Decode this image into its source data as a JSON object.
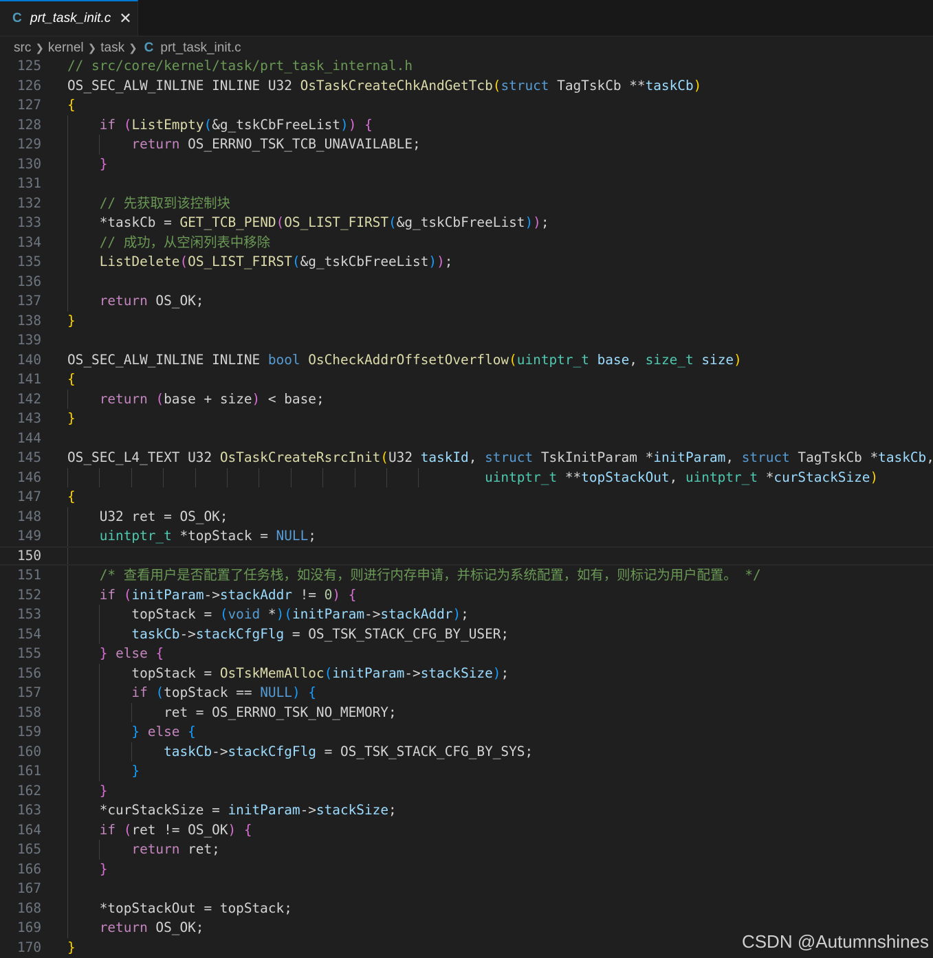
{
  "tab": {
    "icon": "C",
    "title": "prt_task_init.c",
    "close": "✕"
  },
  "breadcrumb": {
    "items": [
      "src",
      "kernel",
      "task"
    ],
    "file_icon": "C",
    "file": "prt_task_init.c"
  },
  "editor": {
    "current_line": 150,
    "lines": [
      {
        "n": "125",
        "g": [],
        "t": [
          [
            "m",
            "// src/core/kernel/task/prt_task_internal.h"
          ]
        ]
      },
      {
        "n": "126",
        "g": [],
        "t": [
          [
            "p",
            "OS_SEC_ALW_INLINE INLINE U32 "
          ],
          [
            "f",
            "OsTaskCreateChkAndGetTcb"
          ],
          [
            "b1",
            "("
          ],
          [
            "k",
            "struct"
          ],
          [
            "p",
            " TagTskCb **"
          ],
          [
            "v",
            "taskCb"
          ],
          [
            "b1",
            ")"
          ]
        ]
      },
      {
        "n": "127",
        "g": [],
        "t": [
          [
            "b1",
            "{"
          ]
        ]
      },
      {
        "n": "128",
        "g": [
          0
        ],
        "t": [
          [
            "p",
            "    "
          ],
          [
            "c",
            "if"
          ],
          [
            "p",
            " "
          ],
          [
            "b2",
            "("
          ],
          [
            "f",
            "ListEmpty"
          ],
          [
            "b3",
            "("
          ],
          [
            "p",
            "&g_tskCbFreeList"
          ],
          [
            "b3",
            ")"
          ],
          [
            "b2",
            ")"
          ],
          [
            "p",
            " "
          ],
          [
            "b2",
            "{"
          ]
        ]
      },
      {
        "n": "129",
        "g": [
          0,
          1
        ],
        "t": [
          [
            "p",
            "        "
          ],
          [
            "c",
            "return"
          ],
          [
            "p",
            " OS_ERRNO_TSK_TCB_UNAVAILABLE;"
          ]
        ]
      },
      {
        "n": "130",
        "g": [
          0
        ],
        "t": [
          [
            "p",
            "    "
          ],
          [
            "b2",
            "}"
          ]
        ]
      },
      {
        "n": "131",
        "g": [
          0
        ],
        "t": []
      },
      {
        "n": "132",
        "g": [
          0
        ],
        "t": [
          [
            "p",
            "    "
          ],
          [
            "m",
            "// 先获取到该控制块"
          ]
        ]
      },
      {
        "n": "133",
        "g": [
          0
        ],
        "t": [
          [
            "p",
            "    *taskCb = "
          ],
          [
            "f",
            "GET_TCB_PEND"
          ],
          [
            "b2",
            "("
          ],
          [
            "f",
            "OS_LIST_FIRST"
          ],
          [
            "b3",
            "("
          ],
          [
            "p",
            "&g_tskCbFreeList"
          ],
          [
            "b3",
            ")"
          ],
          [
            "b2",
            ")"
          ],
          [
            "p",
            ";"
          ]
        ]
      },
      {
        "n": "134",
        "g": [
          0
        ],
        "t": [
          [
            "p",
            "    "
          ],
          [
            "m",
            "// 成功，从空闲列表中移除"
          ]
        ]
      },
      {
        "n": "135",
        "g": [
          0
        ],
        "t": [
          [
            "p",
            "    "
          ],
          [
            "f",
            "ListDelete"
          ],
          [
            "b2",
            "("
          ],
          [
            "f",
            "OS_LIST_FIRST"
          ],
          [
            "b3",
            "("
          ],
          [
            "p",
            "&g_tskCbFreeList"
          ],
          [
            "b3",
            ")"
          ],
          [
            "b2",
            ")"
          ],
          [
            "p",
            ";"
          ]
        ]
      },
      {
        "n": "136",
        "g": [
          0
        ],
        "t": []
      },
      {
        "n": "137",
        "g": [
          0
        ],
        "t": [
          [
            "p",
            "    "
          ],
          [
            "c",
            "return"
          ],
          [
            "p",
            " OS_OK;"
          ]
        ]
      },
      {
        "n": "138",
        "g": [],
        "t": [
          [
            "b1",
            "}"
          ]
        ]
      },
      {
        "n": "139",
        "g": [],
        "t": []
      },
      {
        "n": "140",
        "g": [],
        "t": [
          [
            "p",
            "OS_SEC_ALW_INLINE INLINE "
          ],
          [
            "k",
            "bool"
          ],
          [
            "p",
            " "
          ],
          [
            "f",
            "OsCheckAddrOffsetOverflow"
          ],
          [
            "b1",
            "("
          ],
          [
            "t",
            "uintptr_t"
          ],
          [
            "p",
            " "
          ],
          [
            "v",
            "base"
          ],
          [
            "p",
            ", "
          ],
          [
            "t",
            "size_t"
          ],
          [
            "p",
            " "
          ],
          [
            "v",
            "size"
          ],
          [
            "b1",
            ")"
          ]
        ]
      },
      {
        "n": "141",
        "g": [],
        "t": [
          [
            "b1",
            "{"
          ]
        ]
      },
      {
        "n": "142",
        "g": [
          0
        ],
        "t": [
          [
            "p",
            "    "
          ],
          [
            "c",
            "return"
          ],
          [
            "p",
            " "
          ],
          [
            "b2",
            "("
          ],
          [
            "p",
            "base + size"
          ],
          [
            "b2",
            ")"
          ],
          [
            "p",
            " < base;"
          ]
        ]
      },
      {
        "n": "143",
        "g": [],
        "t": [
          [
            "b1",
            "}"
          ]
        ]
      },
      {
        "n": "144",
        "g": [],
        "t": []
      },
      {
        "n": "145",
        "g": [],
        "t": [
          [
            "p",
            "OS_SEC_L4_TEXT U32 "
          ],
          [
            "f",
            "OsTaskCreateRsrcInit"
          ],
          [
            "b1",
            "("
          ],
          [
            "p",
            "U32 "
          ],
          [
            "v",
            "taskId"
          ],
          [
            "p",
            ", "
          ],
          [
            "k",
            "struct"
          ],
          [
            "p",
            " TskInitParam *"
          ],
          [
            "v",
            "initParam"
          ],
          [
            "p",
            ", "
          ],
          [
            "k",
            "struct"
          ],
          [
            "p",
            " TagTskCb *"
          ],
          [
            "v",
            "taskCb"
          ],
          [
            "p",
            ","
          ]
        ]
      },
      {
        "n": "146",
        "g": [
          0,
          1,
          2,
          3,
          4,
          5,
          6,
          7,
          8,
          9,
          10,
          11
        ],
        "t": [
          [
            "p",
            "                                                    "
          ],
          [
            "t",
            "uintptr_t"
          ],
          [
            "p",
            " **"
          ],
          [
            "v",
            "topStackOut"
          ],
          [
            "p",
            ", "
          ],
          [
            "t",
            "uintptr_t"
          ],
          [
            "p",
            " *"
          ],
          [
            "v",
            "curStackSize"
          ],
          [
            "b1",
            ")"
          ]
        ]
      },
      {
        "n": "147",
        "g": [],
        "t": [
          [
            "b1",
            "{"
          ]
        ]
      },
      {
        "n": "148",
        "g": [
          0
        ],
        "t": [
          [
            "p",
            "    U32 ret = OS_OK;"
          ]
        ]
      },
      {
        "n": "149",
        "g": [
          0
        ],
        "t": [
          [
            "p",
            "    "
          ],
          [
            "t",
            "uintptr_t"
          ],
          [
            "p",
            " *topStack = "
          ],
          [
            "k",
            "NULL"
          ],
          [
            "p",
            ";"
          ]
        ]
      },
      {
        "n": "150",
        "g": [
          0
        ],
        "t": []
      },
      {
        "n": "151",
        "g": [
          0
        ],
        "t": [
          [
            "p",
            "    "
          ],
          [
            "m",
            "/* 查看用户是否配置了任务栈，如没有，则进行内存申请，并标记为系统配置，如有，则标记为用户配置。 */"
          ]
        ]
      },
      {
        "n": "152",
        "g": [
          0
        ],
        "t": [
          [
            "p",
            "    "
          ],
          [
            "c",
            "if"
          ],
          [
            "p",
            " "
          ],
          [
            "b2",
            "("
          ],
          [
            "v",
            "initParam"
          ],
          [
            "p",
            "->"
          ],
          [
            "v",
            "stackAddr"
          ],
          [
            "p",
            " != "
          ],
          [
            "n",
            "0"
          ],
          [
            "b2",
            ")"
          ],
          [
            "p",
            " "
          ],
          [
            "b2",
            "{"
          ]
        ]
      },
      {
        "n": "153",
        "g": [
          0,
          1
        ],
        "t": [
          [
            "p",
            "        topStack = "
          ],
          [
            "b3",
            "("
          ],
          [
            "k",
            "void"
          ],
          [
            "p",
            " *"
          ],
          [
            "b3",
            ")"
          ],
          [
            "b3",
            "("
          ],
          [
            "v",
            "initParam"
          ],
          [
            "p",
            "->"
          ],
          [
            "v",
            "stackAddr"
          ],
          [
            "b3",
            ")"
          ],
          [
            "p",
            ";"
          ]
        ]
      },
      {
        "n": "154",
        "g": [
          0,
          1
        ],
        "t": [
          [
            "p",
            "        "
          ],
          [
            "v",
            "taskCb"
          ],
          [
            "p",
            "->"
          ],
          [
            "v",
            "stackCfgFlg"
          ],
          [
            "p",
            " = OS_TSK_STACK_CFG_BY_USER;"
          ]
        ]
      },
      {
        "n": "155",
        "g": [
          0
        ],
        "t": [
          [
            "p",
            "    "
          ],
          [
            "b2",
            "}"
          ],
          [
            "p",
            " "
          ],
          [
            "c",
            "else"
          ],
          [
            "p",
            " "
          ],
          [
            "b2",
            "{"
          ]
        ]
      },
      {
        "n": "156",
        "g": [
          0,
          1
        ],
        "t": [
          [
            "p",
            "        topStack = "
          ],
          [
            "f",
            "OsTskMemAlloc"
          ],
          [
            "b3",
            "("
          ],
          [
            "v",
            "initParam"
          ],
          [
            "p",
            "->"
          ],
          [
            "v",
            "stackSize"
          ],
          [
            "b3",
            ")"
          ],
          [
            "p",
            ";"
          ]
        ]
      },
      {
        "n": "157",
        "g": [
          0,
          1
        ],
        "t": [
          [
            "p",
            "        "
          ],
          [
            "c",
            "if"
          ],
          [
            "p",
            " "
          ],
          [
            "b3",
            "("
          ],
          [
            "p",
            "topStack == "
          ],
          [
            "k",
            "NULL"
          ],
          [
            "b3",
            ")"
          ],
          [
            "p",
            " "
          ],
          [
            "b3",
            "{"
          ]
        ]
      },
      {
        "n": "158",
        "g": [
          0,
          1,
          2
        ],
        "t": [
          [
            "p",
            "            ret = OS_ERRNO_TSK_NO_MEMORY;"
          ]
        ]
      },
      {
        "n": "159",
        "g": [
          0,
          1
        ],
        "t": [
          [
            "p",
            "        "
          ],
          [
            "b3",
            "}"
          ],
          [
            "p",
            " "
          ],
          [
            "c",
            "else"
          ],
          [
            "p",
            " "
          ],
          [
            "b3",
            "{"
          ]
        ]
      },
      {
        "n": "160",
        "g": [
          0,
          1,
          2
        ],
        "t": [
          [
            "p",
            "            "
          ],
          [
            "v",
            "taskCb"
          ],
          [
            "p",
            "->"
          ],
          [
            "v",
            "stackCfgFlg"
          ],
          [
            "p",
            " = OS_TSK_STACK_CFG_BY_SYS;"
          ]
        ]
      },
      {
        "n": "161",
        "g": [
          0,
          1
        ],
        "t": [
          [
            "p",
            "        "
          ],
          [
            "b3",
            "}"
          ]
        ]
      },
      {
        "n": "162",
        "g": [
          0
        ],
        "t": [
          [
            "p",
            "    "
          ],
          [
            "b2",
            "}"
          ]
        ]
      },
      {
        "n": "163",
        "g": [
          0
        ],
        "t": [
          [
            "p",
            "    *curStackSize = "
          ],
          [
            "v",
            "initParam"
          ],
          [
            "p",
            "->"
          ],
          [
            "v",
            "stackSize"
          ],
          [
            "p",
            ";"
          ]
        ]
      },
      {
        "n": "164",
        "g": [
          0
        ],
        "t": [
          [
            "p",
            "    "
          ],
          [
            "c",
            "if"
          ],
          [
            "p",
            " "
          ],
          [
            "b2",
            "("
          ],
          [
            "p",
            "ret != OS_OK"
          ],
          [
            "b2",
            ")"
          ],
          [
            "p",
            " "
          ],
          [
            "b2",
            "{"
          ]
        ]
      },
      {
        "n": "165",
        "g": [
          0,
          1
        ],
        "t": [
          [
            "p",
            "        "
          ],
          [
            "c",
            "return"
          ],
          [
            "p",
            " ret;"
          ]
        ]
      },
      {
        "n": "166",
        "g": [
          0
        ],
        "t": [
          [
            "p",
            "    "
          ],
          [
            "b2",
            "}"
          ]
        ]
      },
      {
        "n": "167",
        "g": [
          0
        ],
        "t": []
      },
      {
        "n": "168",
        "g": [
          0
        ],
        "t": [
          [
            "p",
            "    *topStackOut = topStack;"
          ]
        ]
      },
      {
        "n": "169",
        "g": [
          0
        ],
        "t": [
          [
            "p",
            "    "
          ],
          [
            "c",
            "return"
          ],
          [
            "p",
            " OS_OK;"
          ]
        ]
      },
      {
        "n": "170",
        "g": [],
        "t": [
          [
            "b1",
            "}"
          ]
        ]
      }
    ]
  },
  "watermark": "CSDN @Autumnshines"
}
